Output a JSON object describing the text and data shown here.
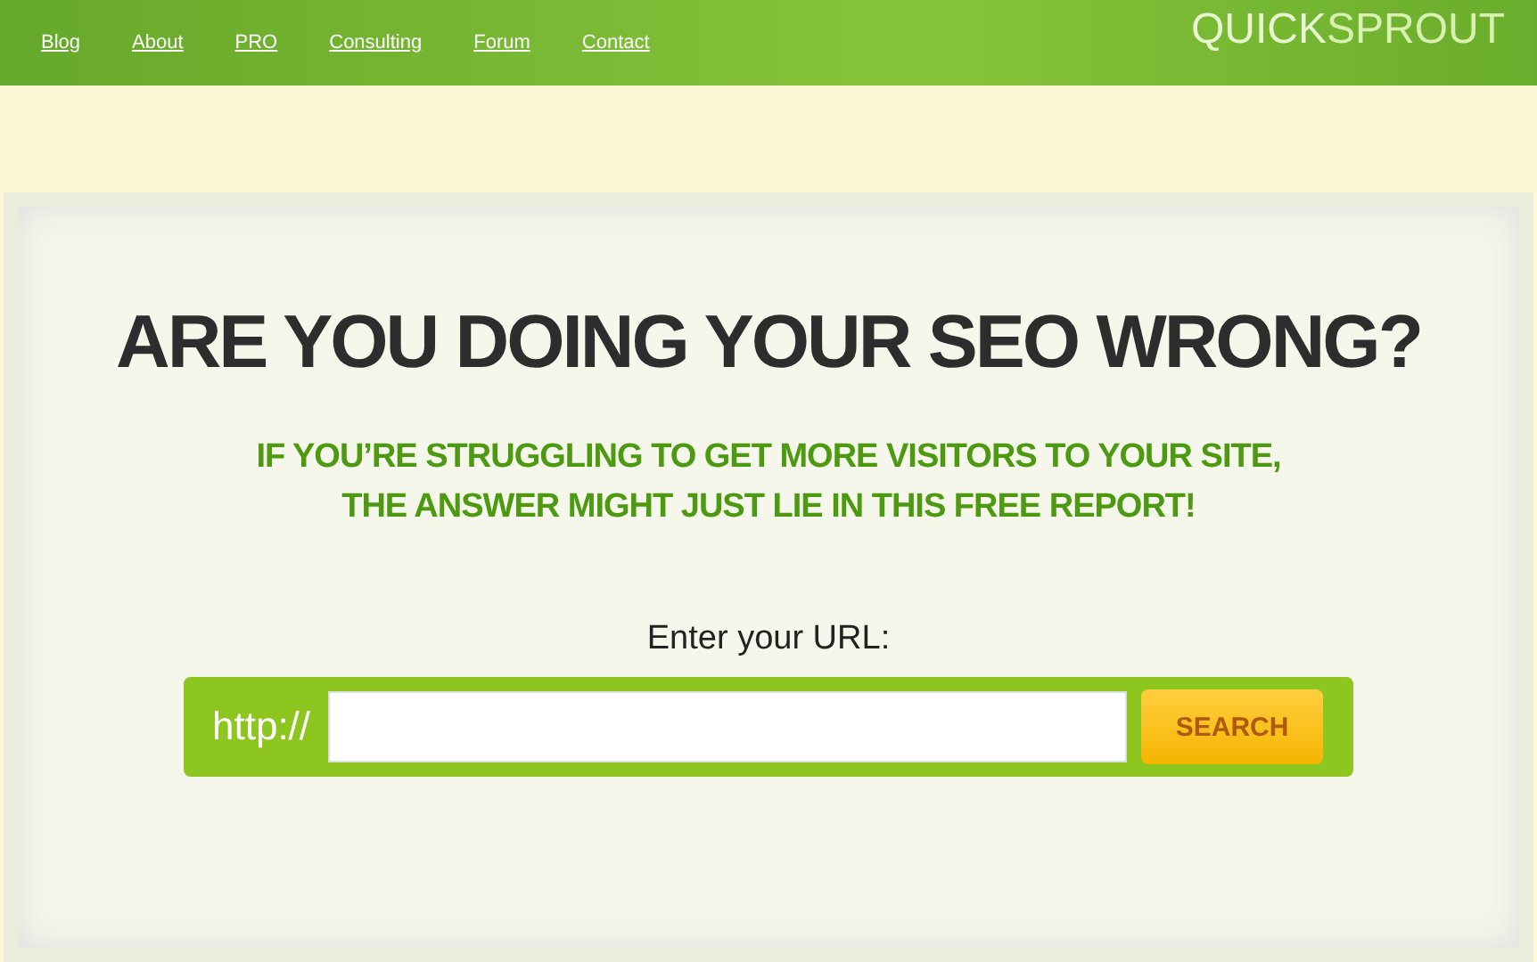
{
  "nav": {
    "links": [
      "Blog",
      "About",
      "PRO",
      "Consulting",
      "Forum",
      "Contact"
    ],
    "logo": {
      "part_1": "QUICK",
      "part_2": "SPROUT"
    }
  },
  "hero": {
    "headline": "ARE YOU DOING YOUR SEO WRONG?",
    "subhead_lines": [
      "IF YOU’RE STRUGGLING TO GET MORE VISITORS TO YOUR SITE,",
      "THE ANSWER MIGHT JUST LIE IN THIS FREE REPORT!"
    ]
  },
  "form": {
    "label": "Enter your URL:",
    "prefix": "http://",
    "button": "SEARCH"
  }
}
